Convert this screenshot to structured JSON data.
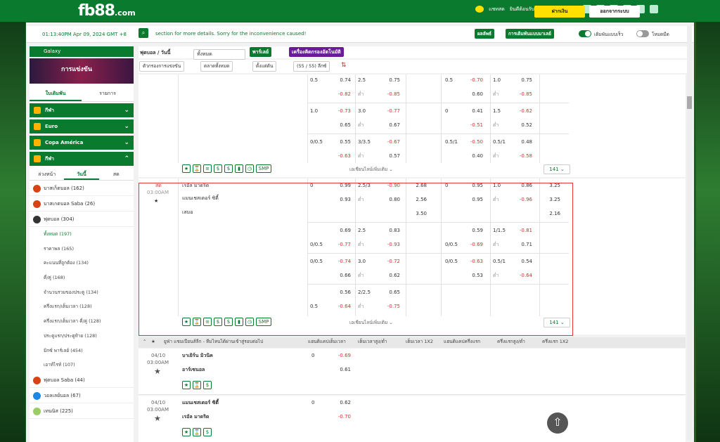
{
  "header": {
    "logo": "fb88",
    "logo_suffix": ".com",
    "chat": "แชทสด",
    "greeting": "ยินดีต้อนรับ",
    "deposit": "ฝากเงิน",
    "logout": "ออกจากระบบ"
  },
  "topbar": {
    "time": "01:13:40PM Apr 09, 2024 GMT +8",
    "marquee": "section for more details. Sorry for the inconvenience caused!",
    "results": "ผลลัพธ์",
    "settings": "การเดิมพันแบบมาเลย์",
    "quickbet": "เดิมพันแบบเร็ว",
    "dark": "โหมดมืด"
  },
  "sidebar": {
    "galaxy": "Galaxy",
    "banner": "การแข่งขัน",
    "tab1": "ใบเดิมพัน",
    "tab2": "รายการ",
    "groups": [
      {
        "label": "กีฬา"
      },
      {
        "label": "Euro"
      },
      {
        "label": "Copa América"
      },
      {
        "label": "กีฬา"
      }
    ],
    "dtabs": [
      "ล่วงหน้า",
      "วันนี้",
      "สด"
    ],
    "sports": [
      {
        "label": "บาสเก็ตบอล",
        "count": "(162)"
      },
      {
        "label": "บาสเกตบอล Saba",
        "count": "(26)"
      },
      {
        "label": "ฟุตบอล",
        "count": "(304)"
      }
    ],
    "subs": [
      {
        "label": "ทั้งหมด",
        "count": "(197)"
      },
      {
        "label": "ราคาพล",
        "count": "(165)"
      },
      {
        "label": "คะแนนที่ถูกต้อง",
        "count": "(134)"
      },
      {
        "label": "คี่/คู่",
        "count": "(168)"
      },
      {
        "label": "จำนวนรวมของประตู",
        "count": "(134)"
      },
      {
        "label": "ครึ่งแรก/เต็มเวลา",
        "count": "(128)"
      },
      {
        "label": "ครึ่งแรก/เต็มเวลา คี่/คู่",
        "count": "(128)"
      },
      {
        "label": "ประตูแรก/ประตูท้าย",
        "count": "(128)"
      },
      {
        "label": "มิกซ์ พาร์เลย์",
        "count": "(454)"
      },
      {
        "label": "เอาท์ไรท์",
        "count": "(107)"
      }
    ],
    "sports2": [
      {
        "label": "ฟุตบอล Saba",
        "count": "(44)"
      },
      {
        "label": "วอลเลย์บอล",
        "count": "(67)"
      },
      {
        "label": "เทนนิส",
        "count": "(225)"
      }
    ]
  },
  "content": {
    "title": "ฟุตบอล / วันนี้",
    "all": "ทั้งหมด",
    "parlay": "พาร์เลย์",
    "calc": "เครื่องคิดกรองอัตโนมัติ",
    "filters": [
      "ตัวกรองการแข่งขัน",
      "ตลาดทั้งหมด",
      "ตั้งแต่ต้น"
    ],
    "leagues": "(55 / 55) ลีกซ์",
    "more": "เอเชียนไลน์เพิ่มเติม",
    "count": "141",
    "smp": "SMP",
    "live": "สด",
    "ltime": "03:00AM",
    "home": "เรอัล มาดริด",
    "away": "แมนเชสเตอร์ ซิตี้",
    "draw": "เสมอ",
    "val_label": "ต่ำ",
    "league": "ยูฟ่า แชมเปียนส์ลีก - ทีมไหนได้ผ่านเข้าสู่รอบต่อไป",
    "league_cols": [
      "แฮนดิแคปเต็มเวลา",
      "เต็มเวลาสูง/ต่ำ",
      "เต็มเวลา 1X2",
      "แฮนดิแคปครึ่งแรก",
      "ครึ่งแรกสูง/ต่ำ",
      "ครึ่งแรก 1X2"
    ],
    "m2": {
      "date": "04/10",
      "time": "03:00AM",
      "home": "บาเยิร์น มิวนิค",
      "away": "อาร์เซนอล",
      "v1": "-0.69",
      "v2": "0.61",
      "h": "0"
    },
    "m3": {
      "date": "04/10",
      "time": "03:00AM",
      "home": "แมนเชสเตอร์ ซิตี้",
      "away": "เรอัล มาดริด",
      "v1": "0.62",
      "v2": "-0.70",
      "h": "0"
    }
  },
  "colors": {
    "brand": "#0a7a2f",
    "accent": "#ffe000",
    "neg": "#d32f2f"
  }
}
